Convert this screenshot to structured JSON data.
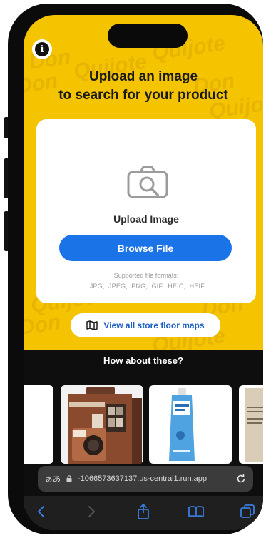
{
  "colors": {
    "accent_yellow": "#f4c400",
    "primary_blue": "#1b73e8",
    "link_blue": "#1b5fc4"
  },
  "background_words": [
    "Don",
    "Quijote",
    "Don",
    "Quijote",
    "Don",
    "Quijote",
    "Don",
    "Quijote",
    "Don",
    "Quijote"
  ],
  "header": {
    "info_icon_glyph": "i",
    "title_line1": "Upload an image",
    "title_line2": "to search for your product"
  },
  "upload": {
    "label": "Upload Image",
    "browse_label": "Browse File",
    "formats_title": "Supported file formats:",
    "formats_list": ".JPG, .JPEG, .PNG, .GIF, .HEIC, .HEIF"
  },
  "floor_maps": {
    "label": "View all store floor maps",
    "icon": "map-icon"
  },
  "suggestions": {
    "title": "How about these?"
  },
  "browser": {
    "aa_label": "ぁあ",
    "url": "-1066573637137.us-central1.run.app",
    "toolbar_icons": [
      "back-icon",
      "forward-icon",
      "share-icon",
      "bookmarks-icon",
      "tabs-icon"
    ]
  }
}
